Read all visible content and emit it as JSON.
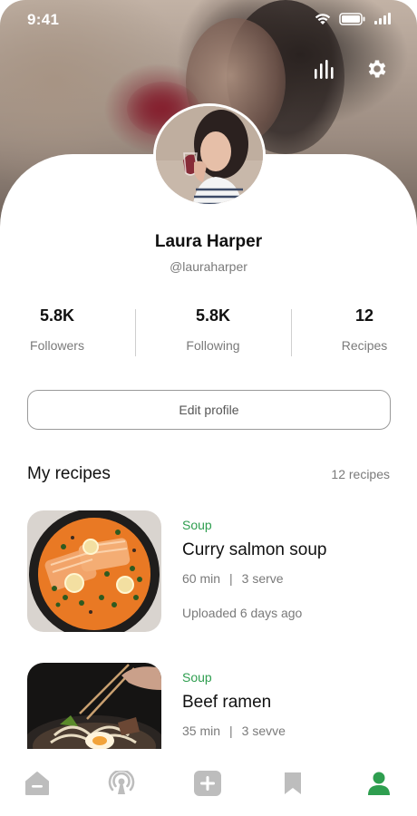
{
  "status": {
    "time": "9:41"
  },
  "profile": {
    "name": "Laura Harper",
    "handle": "@lauraharper",
    "edit_label": "Edit profile"
  },
  "stats": [
    {
      "value": "5.8K",
      "label": "Followers"
    },
    {
      "value": "5.8K",
      "label": "Following"
    },
    {
      "value": "12",
      "label": "Recipes"
    }
  ],
  "recipes_section": {
    "title": "My recipes",
    "count": "12 recipes"
  },
  "recipes": [
    {
      "category": "Soup",
      "title": "Curry salmon soup",
      "time": "60 min",
      "serve": "3 serve",
      "uploaded": "Uploaded 6 days ago"
    },
    {
      "category": "Soup",
      "title": "Beef ramen",
      "time": "35 min",
      "serve": "3 sevve"
    }
  ],
  "tabs": [
    {
      "icon": "home-icon",
      "active": false
    },
    {
      "icon": "broadcast-icon",
      "active": false
    },
    {
      "icon": "add-icon",
      "active": false
    },
    {
      "icon": "bookmark-icon",
      "active": false
    },
    {
      "icon": "profile-icon",
      "active": true
    }
  ],
  "colors": {
    "accent": "#2e9e4f",
    "inactive_icon": "#bdbdbd",
    "text": "#111111",
    "muted": "#7a7a7a"
  }
}
